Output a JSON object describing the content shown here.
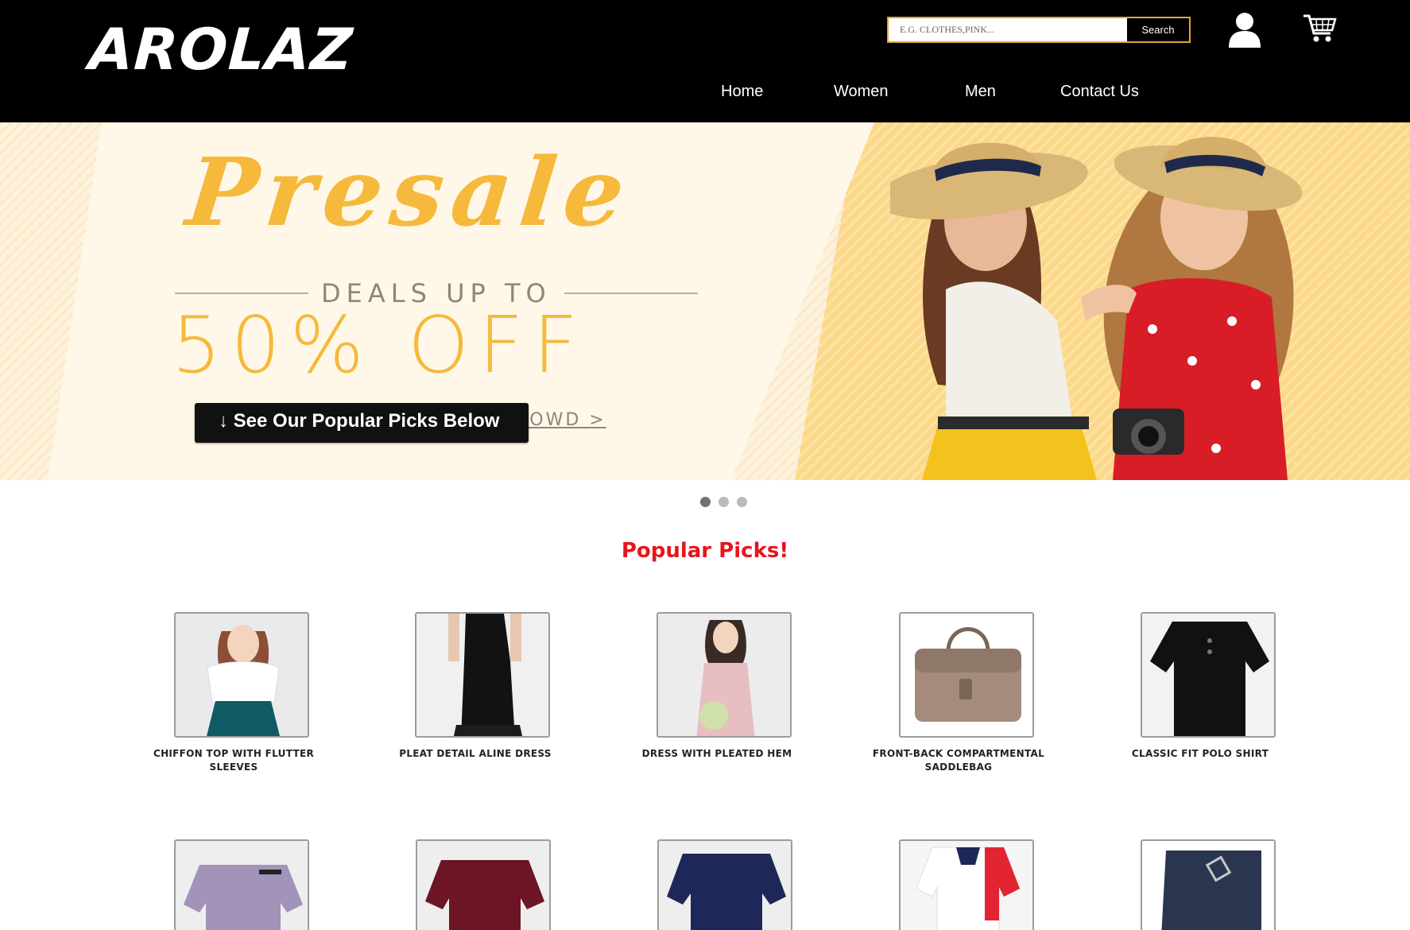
{
  "header": {
    "logo": "AROLAZ",
    "search": {
      "placeholder": "E.G. CLOTHES,PINK...",
      "button_label": "Search"
    },
    "icons": [
      "user-icon",
      "cart-icon"
    ],
    "nav": [
      {
        "label": "Home"
      },
      {
        "label": "Women"
      },
      {
        "label": "Men"
      },
      {
        "label": "Contact Us"
      }
    ]
  },
  "hero": {
    "headline": "Presale",
    "deals_text": "DEALS UP TO",
    "discount_text": "50% OFF",
    "behind_button_text": "ROWD >",
    "cta_label": "↓ See Our Popular Picks Below",
    "carousel": {
      "slides": 3,
      "active": 1
    }
  },
  "popular": {
    "title": "Popular Picks!",
    "products": [
      {
        "name": "CHIFFON TOP WITH FLUTTER SLEEVES"
      },
      {
        "name": "PLEAT DETAIL ALINE DRESS"
      },
      {
        "name": "DRESS WITH PLEATED HEM"
      },
      {
        "name": "FRONT-BACK COMPARTMENTAL SADDLEBAG"
      },
      {
        "name": "CLASSIC FIT POLO SHIRT"
      },
      {
        "name": ""
      },
      {
        "name": ""
      },
      {
        "name": ""
      },
      {
        "name": ""
      },
      {
        "name": ""
      }
    ]
  },
  "colors": {
    "header_bg": "#000000",
    "accent_gold": "#f6b93b",
    "title_red": "#e8141c",
    "search_border": "#e0a33a"
  }
}
